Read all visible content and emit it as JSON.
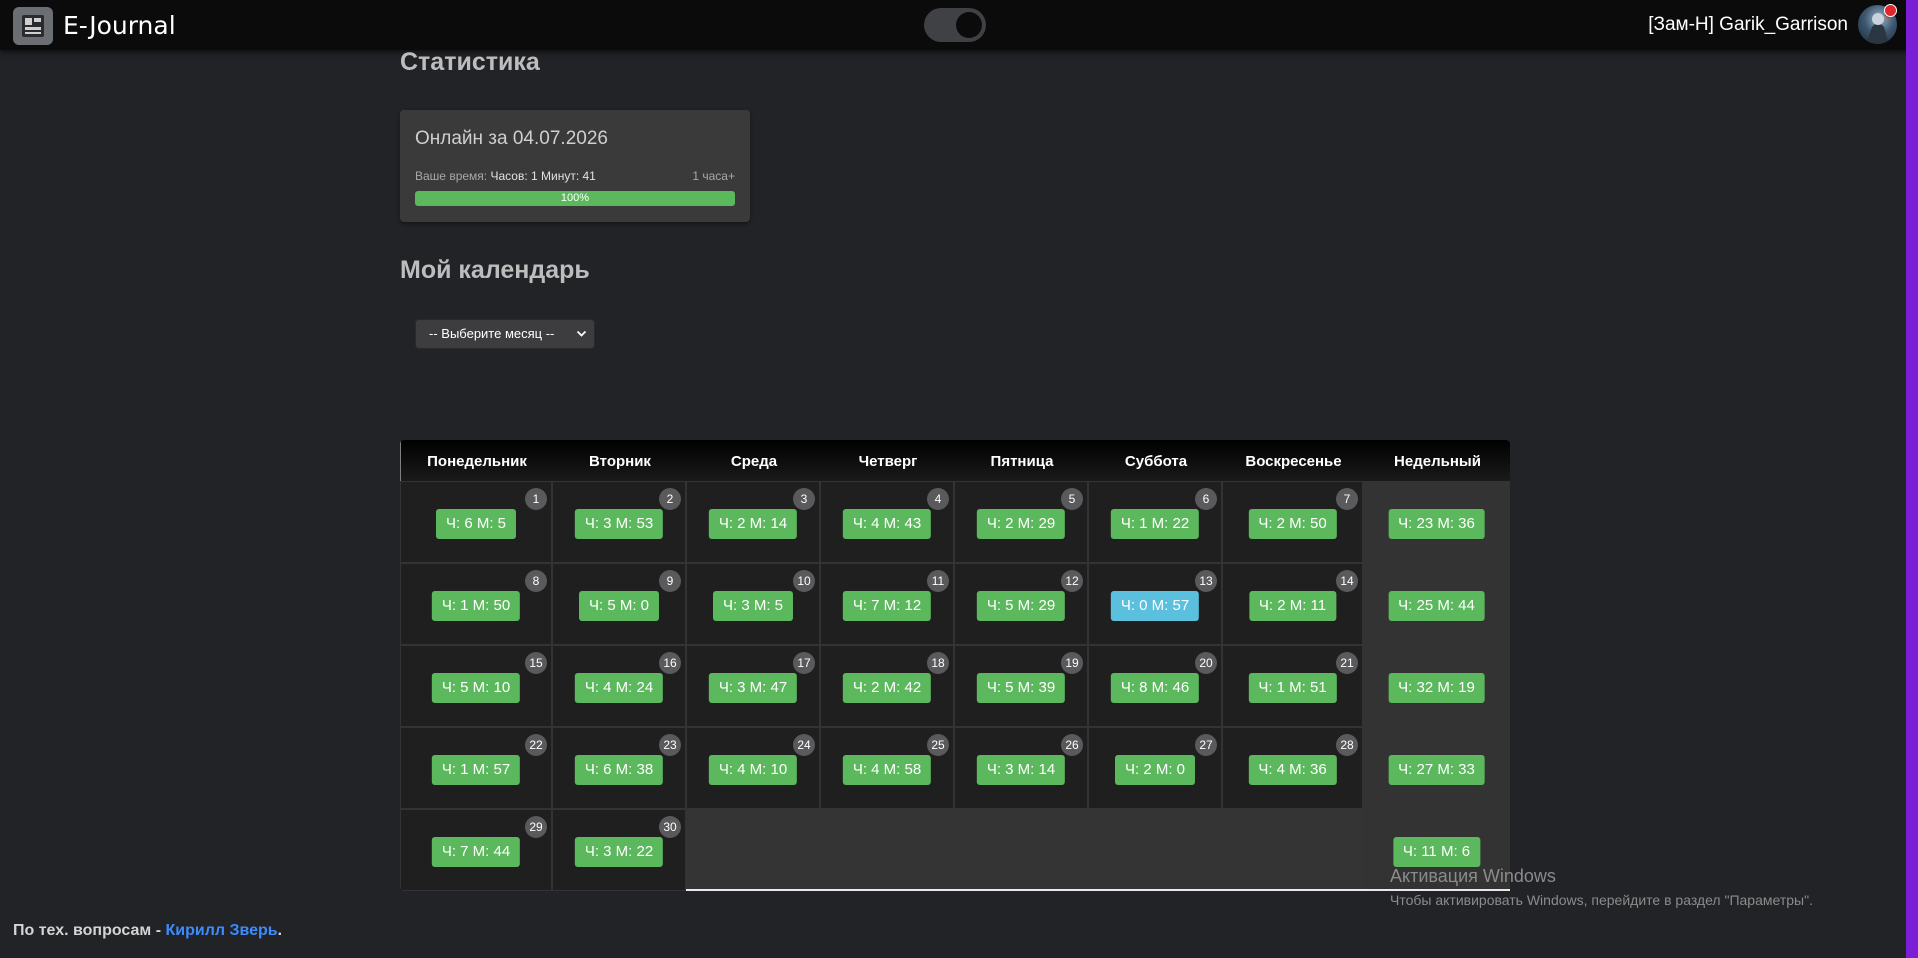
{
  "topbar": {
    "brand": "E-Journal",
    "user": "[Зам-Н] Garik_Garrison"
  },
  "stats": {
    "heading": "Статистика",
    "online_title": "Онлайн за 04.07.2026",
    "your_time_label": "Ваше время:",
    "your_time_value": "Часов: 1 Минут: 41",
    "goal": "1 часа+",
    "progress_percent": 100,
    "progress_label": "100%"
  },
  "calendar_section": {
    "heading": "Мой календарь",
    "month_select_value": "-- Выберите месяц --"
  },
  "calendar": {
    "headers": [
      "Понедельник",
      "Вторник",
      "Среда",
      "Четверг",
      "Пятница",
      "Суббота",
      "Воскресенье",
      "Недельный"
    ],
    "weeks": [
      {
        "days": [
          {
            "day": "1",
            "value": "Ч: 6 М: 5",
            "status": "success"
          },
          {
            "day": "2",
            "value": "Ч: 3 М: 53",
            "status": "success"
          },
          {
            "day": "3",
            "value": "Ч: 2 М: 14",
            "status": "success"
          },
          {
            "day": "4",
            "value": "Ч: 4 М: 43",
            "status": "success"
          },
          {
            "day": "5",
            "value": "Ч: 2 М: 29",
            "status": "success"
          },
          {
            "day": "6",
            "value": "Ч: 1 М: 22",
            "status": "success"
          },
          {
            "day": "7",
            "value": "Ч: 2 М: 50",
            "status": "success"
          }
        ],
        "total": "Ч: 23 М: 36"
      },
      {
        "days": [
          {
            "day": "8",
            "value": "Ч: 1 М: 50",
            "status": "success"
          },
          {
            "day": "9",
            "value": "Ч: 5 М: 0",
            "status": "success"
          },
          {
            "day": "10",
            "value": "Ч: 3 М: 5",
            "status": "success"
          },
          {
            "day": "11",
            "value": "Ч: 7 М: 12",
            "status": "success"
          },
          {
            "day": "12",
            "value": "Ч: 5 М: 29",
            "status": "success"
          },
          {
            "day": "13",
            "value": "Ч: 0 М: 57",
            "status": "info"
          },
          {
            "day": "14",
            "value": "Ч: 2 М: 11",
            "status": "success"
          }
        ],
        "total": "Ч: 25 М: 44"
      },
      {
        "days": [
          {
            "day": "15",
            "value": "Ч: 5 М: 10",
            "status": "success"
          },
          {
            "day": "16",
            "value": "Ч: 4 М: 24",
            "status": "success"
          },
          {
            "day": "17",
            "value": "Ч: 3 М: 47",
            "status": "success"
          },
          {
            "day": "18",
            "value": "Ч: 2 М: 42",
            "status": "success"
          },
          {
            "day": "19",
            "value": "Ч: 5 М: 39",
            "status": "success"
          },
          {
            "day": "20",
            "value": "Ч: 8 М: 46",
            "status": "success"
          },
          {
            "day": "21",
            "value": "Ч: 1 М: 51",
            "status": "success"
          }
        ],
        "total": "Ч: 32 М: 19"
      },
      {
        "days": [
          {
            "day": "22",
            "value": "Ч: 1 М: 57",
            "status": "success"
          },
          {
            "day": "23",
            "value": "Ч: 6 М: 38",
            "status": "success"
          },
          {
            "day": "24",
            "value": "Ч: 4 М: 10",
            "status": "success"
          },
          {
            "day": "25",
            "value": "Ч: 4 М: 58",
            "status": "success"
          },
          {
            "day": "26",
            "value": "Ч: 3 М: 14",
            "status": "success"
          },
          {
            "day": "27",
            "value": "Ч: 2 М: 0",
            "status": "success"
          },
          {
            "day": "28",
            "value": "Ч: 4 М: 36",
            "status": "success"
          }
        ],
        "total": "Ч: 27 М: 33"
      },
      {
        "days": [
          {
            "day": "29",
            "value": "Ч: 7 М: 44",
            "status": "success"
          },
          {
            "day": "30",
            "value": "Ч: 3 М: 22",
            "status": "success"
          }
        ],
        "total": "Ч: 11 М: 6"
      }
    ]
  },
  "footer": {
    "text": "По тех. вопросам - ",
    "link": "Кирилл Зверь",
    "tail": "."
  },
  "watermark": {
    "title": "Активация Windows",
    "subtitle": "Чтобы активировать Windows, перейдите в раздел \"Параметры\"."
  },
  "colors": {
    "success": "#5cb85c",
    "info": "#5bc0de",
    "link": "#3d8bfd",
    "accent": "#7a1fd6"
  }
}
